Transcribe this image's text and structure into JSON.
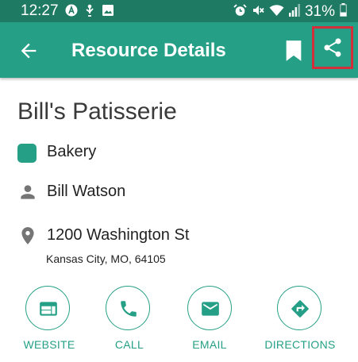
{
  "status_bar": {
    "time": "12:27",
    "battery": "31%",
    "icons": [
      "a-circle-icon",
      "usb-person-icon",
      "image-icon",
      "alarm-icon",
      "mute-icon",
      "wifi-icon",
      "signal-icon",
      "battery-icon"
    ]
  },
  "app_bar": {
    "title": "Resource Details",
    "back_icon": "arrow-back-icon",
    "bookmark_icon": "bookmark-icon",
    "share_icon": "share-icon"
  },
  "resource": {
    "name": "Bill's Patisserie",
    "category": "Bakery",
    "contact": "Bill Watson",
    "address_line1": "1200 Washington St",
    "address_line2": "Kansas City, MO, 64105"
  },
  "actions": [
    {
      "label": "WEBSITE",
      "icon": "web-icon"
    },
    {
      "label": "CALL",
      "icon": "phone-icon"
    },
    {
      "label": "EMAIL",
      "icon": "email-icon"
    },
    {
      "label": "DIRECTIONS",
      "icon": "directions-icon"
    }
  ],
  "colors": {
    "accent": "#25a086",
    "status_bar": "#1f7a63",
    "highlight": "#d32f3a",
    "icon_gray": "#757575"
  }
}
